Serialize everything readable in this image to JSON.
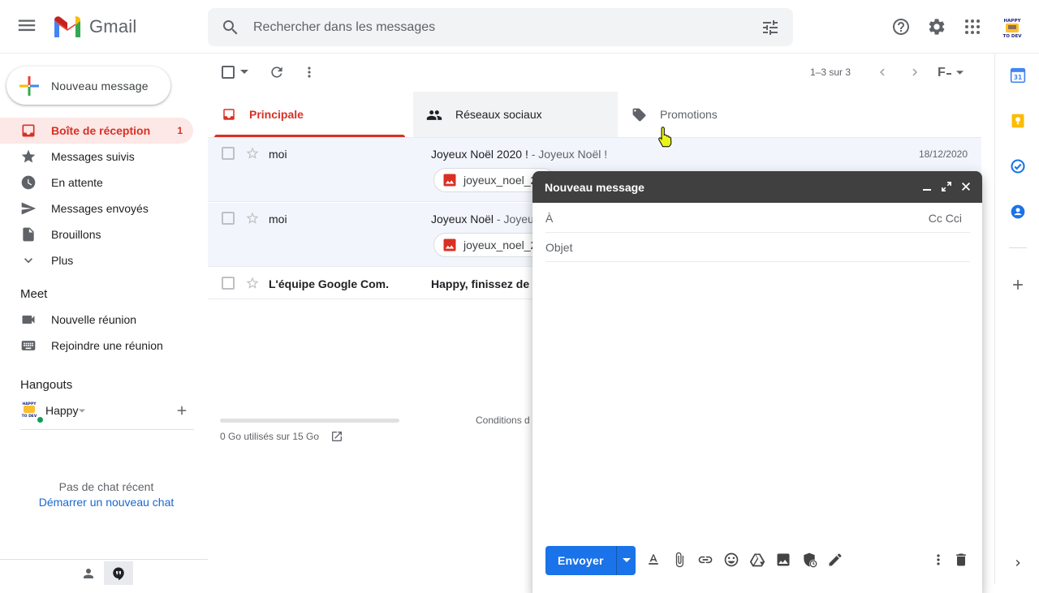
{
  "header": {
    "logo_text": "Gmail",
    "search_placeholder": "Rechercher dans les messages",
    "avatar_text": "HAPPY TO DEV"
  },
  "sidebar": {
    "compose_label": "Nouveau message",
    "items": [
      {
        "label": "Boîte de réception",
        "count": "1",
        "icon": "inbox-icon",
        "active": true
      },
      {
        "label": "Messages suivis",
        "icon": "star-icon"
      },
      {
        "label": "En attente",
        "icon": "clock-icon"
      },
      {
        "label": "Messages envoyés",
        "icon": "send-icon"
      },
      {
        "label": "Brouillons",
        "icon": "draft-icon"
      },
      {
        "label": "Plus",
        "icon": "chevron-down-icon"
      }
    ],
    "meet": {
      "title": "Meet",
      "items": [
        {
          "label": "Nouvelle réunion",
          "icon": "video-icon"
        },
        {
          "label": "Rejoindre une réunion",
          "icon": "keyboard-icon"
        }
      ]
    },
    "hangouts": {
      "title": "Hangouts",
      "user": "Happy",
      "no_chat": "Pas de chat récent",
      "start_chat": "Démarrer un nouveau chat"
    }
  },
  "toolbar": {
    "pager": "1–3 sur 3",
    "input_tool": "F"
  },
  "tabs": [
    {
      "label": "Principale",
      "icon": "inbox-icon",
      "active": true
    },
    {
      "label": "Réseaux sociaux",
      "icon": "people-icon"
    },
    {
      "label": "Promotions",
      "icon": "tag-icon"
    }
  ],
  "emails": [
    {
      "sender": "moi",
      "subject": "Joyeux Noël 2020 !",
      "snippet": " - Joyeux Noël !",
      "date": "18/12/2020",
      "attachment": "joyeux_noel_2",
      "read": true
    },
    {
      "sender": "moi",
      "subject": "Joyeux Noël",
      "snippet": " - Joyeu",
      "date": "",
      "attachment": "joyeux_noel_2",
      "read": true
    },
    {
      "sender": "L'équipe Google Com.",
      "subject": "Happy, finissez de c",
      "snippet": "",
      "date": "",
      "attachment": "",
      "read": false
    }
  ],
  "footer": {
    "storage": "0 Go utilisés sur 15 Go",
    "terms": "Conditions d"
  },
  "compose_window": {
    "title": "Nouveau message",
    "to_label": "À",
    "cc_bcc": "Cc Cci",
    "subject_placeholder": "Objet",
    "send_label": "Envoyer"
  },
  "colors": {
    "accent_red": "#d93025",
    "active_bg": "#fce8e6",
    "send_blue": "#1a73e8",
    "compose_header": "#404040"
  }
}
